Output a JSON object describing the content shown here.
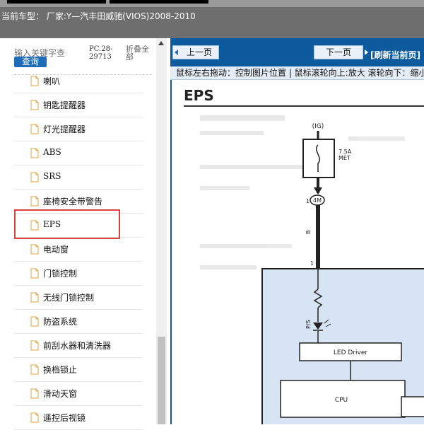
{
  "header": {
    "title": "当前车型： 厂家:Y—汽丰田威驰(VIOS)2008-2010"
  },
  "sidebar": {
    "search_placeholder": "输入关键字查",
    "query_label": "查询",
    "code": "PC.28-29713",
    "collapse_label": "折叠全部",
    "items": [
      {
        "label": "喇叭"
      },
      {
        "label": "钥匙提醒器"
      },
      {
        "label": "灯光提醒器"
      },
      {
        "label": "ABS"
      },
      {
        "label": "SRS"
      },
      {
        "label": "座椅安全带警告"
      },
      {
        "label": "EPS"
      },
      {
        "label": "电动窗"
      },
      {
        "label": "门锁控制"
      },
      {
        "label": "无线门锁控制"
      },
      {
        "label": "防盗系统"
      },
      {
        "label": "前刮水器和清洗器"
      },
      {
        "label": "换档锁止"
      },
      {
        "label": "滑动天窗"
      },
      {
        "label": "遥控后视镜"
      }
    ],
    "selected_index": 6
  },
  "toolbar": {
    "prev_label": "上一页",
    "next_label": "下一页",
    "refresh_label": "[刷新当前页]"
  },
  "hint": "鼠标左右拖动：控制图片位置 | 鼠标滚轮向上:放大  滚轮向下：缩小",
  "diagram": {
    "title": "EPS",
    "ig_label": "(IG)",
    "fuse_rating": "7.5A",
    "fuse_name": "MET",
    "connector_pin": "1",
    "connector_label": "4M",
    "wire_color": "B",
    "ecu_pin": "1",
    "indicator_label": "P/S",
    "led_driver_label": "LED Driver",
    "cpu_label": "CPU",
    "colors": {
      "ecu_fill": "#d6e4f4",
      "header": "#6e6e6e",
      "toolbar": "#0d5b9c",
      "highlight": "#d9433c"
    }
  }
}
